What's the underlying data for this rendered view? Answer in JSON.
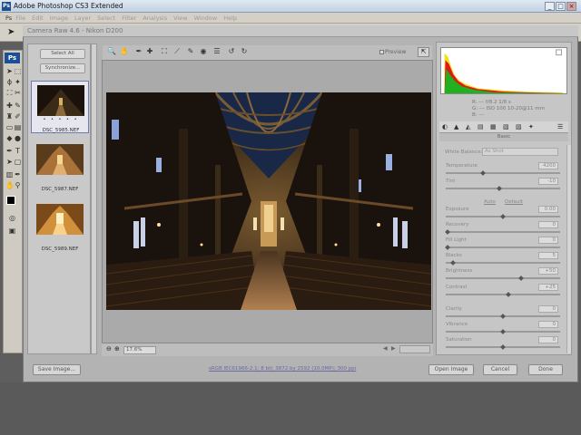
{
  "window": {
    "app_icon": "Ps",
    "title": "Adobe Photoshop CS3 Extended",
    "minimize": "_",
    "maximize": "□",
    "close": "×"
  },
  "menubar": {
    "logo": "Ps",
    "items": [
      "File",
      "Edit",
      "Image",
      "Layer",
      "Select",
      "Filter",
      "Analysis",
      "View",
      "Window",
      "Help"
    ]
  },
  "tools_badge": "Ps",
  "camera_raw": {
    "title": "Camera Raw 4.6  -  Nikon D200",
    "filmstrip": {
      "select_all": "Select All",
      "synchronize": "Synchronize...",
      "stars": "• • • • •",
      "thumbnails": [
        {
          "caption": "DSC_5985.NEF",
          "selected": true
        },
        {
          "caption": "DSC_5987.NEF",
          "selected": false
        },
        {
          "caption": "DSC_5989.NEF",
          "selected": false
        }
      ]
    },
    "toolbar": {
      "icons": [
        "zoom-icon",
        "hand-icon",
        "white-balance-icon",
        "color-sampler-icon",
        "crop-icon",
        "straighten-icon",
        "retouch-icon",
        "red-eye-icon",
        "preferences-icon",
        "rotate-left-icon",
        "rotate-right-icon"
      ],
      "glyphs": [
        "🔍",
        "✋",
        "✒",
        "✚",
        "⛶",
        "⟋",
        "✎",
        "◉",
        "☰",
        "↺",
        "↻"
      ],
      "preview_label": "Preview",
      "fullscreen_glyph": "⇱"
    },
    "zoom_value": "17.6%",
    "histogram": {
      "readout_line1": "R: ---  f/8.2   1/8 s",
      "readout_line2": "G: ---  ISO 100   10-20@11 mm",
      "readout_line3": "B: ---"
    },
    "panel": {
      "tab_glyphs": [
        "◐",
        "▲",
        "◭",
        "▤",
        "▦",
        "▧",
        "▨",
        "✦",
        "☰"
      ],
      "section": "Basic",
      "white_balance_label": "White Balance:",
      "white_balance_value": "As Shot",
      "auto": "Auto",
      "default": "Default",
      "sliders": [
        {
          "label": "Temperature",
          "value": "4200",
          "pos": 0.32
        },
        {
          "label": "Tint",
          "value": "-10",
          "pos": 0.47
        },
        {
          "label": "Exposure",
          "value": "0.00",
          "pos": 0.5
        },
        {
          "label": "Recovery",
          "value": "0",
          "pos": 0.0
        },
        {
          "label": "Fill Light",
          "value": "0",
          "pos": 0.0
        },
        {
          "label": "Blacks",
          "value": "5",
          "pos": 0.05
        },
        {
          "label": "Brightness",
          "value": "+50",
          "pos": 0.66
        },
        {
          "label": "Contrast",
          "value": "+25",
          "pos": 0.55
        },
        {
          "label": "Clarity",
          "value": "0",
          "pos": 0.5
        },
        {
          "label": "Vibrance",
          "value": "0",
          "pos": 0.5
        },
        {
          "label": "Saturation",
          "value": "0",
          "pos": 0.5
        }
      ]
    },
    "bottom": {
      "save_image": "Save Image...",
      "workflow": "sRGB IEC61966-2.1; 8 bit; 3872 by 2592 (10.0MP); 300 ppi",
      "open_image": "Open Image",
      "cancel": "Cancel",
      "done": "Done"
    }
  },
  "colors": {
    "ps_blue": "#1d4f96",
    "dialog_gray": "#b3b3b3",
    "histogram_red": "#e01818",
    "histogram_yellow": "#f0e020",
    "histogram_green": "#20b020"
  }
}
